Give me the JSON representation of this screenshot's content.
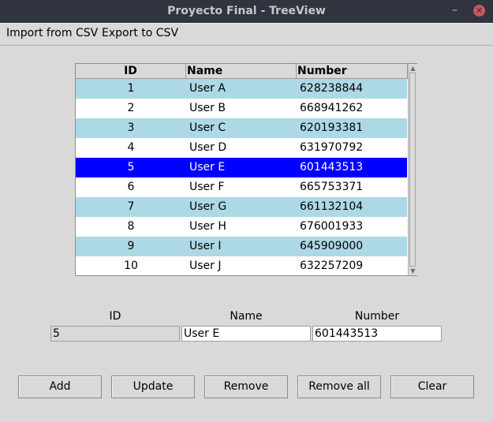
{
  "window": {
    "title": "Proyecto Final - TreeView"
  },
  "menu": [
    "Import from CSV",
    "Export to CSV"
  ],
  "table": {
    "columns": [
      "ID",
      "Name",
      "Number"
    ],
    "rows": [
      {
        "id": "1",
        "name": "User A",
        "number": "628238844",
        "state": "alt"
      },
      {
        "id": "2",
        "name": "User B",
        "number": "668941262",
        "state": ""
      },
      {
        "id": "3",
        "name": "User C",
        "number": "620193381",
        "state": "alt"
      },
      {
        "id": "4",
        "name": "User D",
        "number": "631970792",
        "state": ""
      },
      {
        "id": "5",
        "name": "User E",
        "number": "601443513",
        "state": "selected"
      },
      {
        "id": "6",
        "name": "User F",
        "number": "665753371",
        "state": ""
      },
      {
        "id": "7",
        "name": "User G",
        "number": "661132104",
        "state": "alt"
      },
      {
        "id": "8",
        "name": "User H",
        "number": "676001933",
        "state": ""
      },
      {
        "id": "9",
        "name": "User I",
        "number": "645909000",
        "state": "alt"
      },
      {
        "id": "10",
        "name": "User J",
        "number": "632257209",
        "state": ""
      }
    ]
  },
  "form": {
    "id_label": "ID",
    "name_label": "Name",
    "number_label": "Number",
    "id_value": "5",
    "name_value": "User E",
    "number_value": "601443513"
  },
  "buttons": {
    "add": "Add",
    "update": "Update",
    "remove": "Remove",
    "remove_all": "Remove all",
    "clear": "Clear"
  },
  "colors": {
    "row_alt": "#add8e6",
    "row_selected": "#0000ff",
    "titlebar": "#2f343f",
    "close_button": "#cc575d"
  }
}
